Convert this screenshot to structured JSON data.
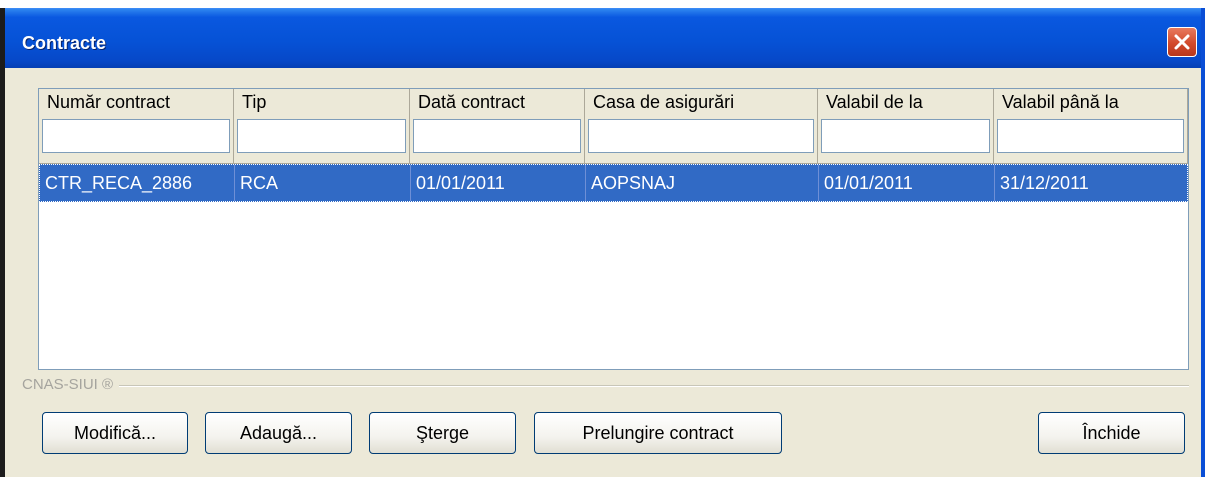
{
  "window": {
    "title": "Contracte"
  },
  "grid": {
    "columns": [
      "Număr contract",
      "Tip",
      "Dată contract",
      "Casa de asigurări",
      "Valabil de la",
      "Valabil până la"
    ],
    "rows": [
      [
        "CTR_RECA_2886",
        "RCA",
        "01/01/2011",
        "AOPSNAJ",
        "01/01/2011",
        "31/12/2011"
      ]
    ]
  },
  "footer": {
    "group_label": "CNAS-SIUI ®"
  },
  "buttons": {
    "modify": "Modifică...",
    "add": "Adaugă...",
    "delete": "Şterge",
    "extend": "Prelungire contract",
    "close": "Închide"
  },
  "colors": {
    "titlebar": "#0652d6",
    "selection": "#316ac5",
    "close_button": "#d24a2c",
    "window_bg": "#ece9d8"
  },
  "icons": {
    "close": "close-icon"
  }
}
